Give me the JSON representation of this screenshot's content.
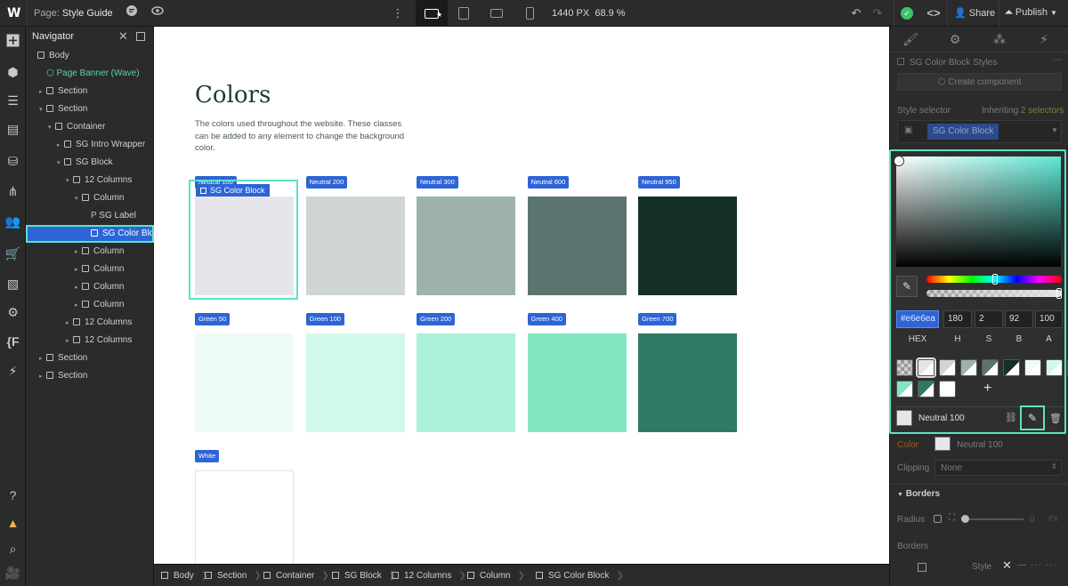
{
  "topbar": {
    "logo": "W",
    "page_prefix": "Page:",
    "page_name": "Style Guide",
    "size": "1440 PX",
    "zoom": "68.9 %",
    "share": "Share",
    "publish": "Publish"
  },
  "navigator": {
    "title": "Navigator",
    "rows": [
      {
        "label": "Body",
        "indent": 0,
        "caret": "",
        "kind": "box"
      },
      {
        "label": "Page Banner (Wave)",
        "indent": 1,
        "caret": "",
        "kind": "component"
      },
      {
        "label": "Section",
        "indent": 1,
        "caret": "▸",
        "kind": "box"
      },
      {
        "label": "Section",
        "indent": 1,
        "caret": "▾",
        "kind": "box"
      },
      {
        "label": "Container",
        "indent": 2,
        "caret": "▾",
        "kind": "box"
      },
      {
        "label": "SG Intro Wrapper",
        "indent": 3,
        "caret": "▸",
        "kind": "box"
      },
      {
        "label": "SG Block",
        "indent": 3,
        "caret": "▾",
        "kind": "box"
      },
      {
        "label": "12 Columns",
        "indent": 4,
        "caret": "▾",
        "kind": "box"
      },
      {
        "label": "Column",
        "indent": 5,
        "caret": "▾",
        "kind": "box"
      },
      {
        "label": "SG Label",
        "indent": 6,
        "caret": "",
        "kind": "p"
      },
      {
        "label": "SG Color Bloc",
        "indent": 6,
        "caret": "",
        "kind": "box",
        "selected": true
      },
      {
        "label": "Column",
        "indent": 5,
        "caret": "▸",
        "kind": "box"
      },
      {
        "label": "Column",
        "indent": 5,
        "caret": "▸",
        "kind": "box"
      },
      {
        "label": "Column",
        "indent": 5,
        "caret": "▸",
        "kind": "box"
      },
      {
        "label": "Column",
        "indent": 5,
        "caret": "▸",
        "kind": "box"
      },
      {
        "label": "12 Columns",
        "indent": 4,
        "caret": "▸",
        "kind": "box"
      },
      {
        "label": "12 Columns",
        "indent": 4,
        "caret": "▸",
        "kind": "box"
      },
      {
        "label": "Section",
        "indent": 1,
        "caret": "▸",
        "kind": "box"
      },
      {
        "label": "Section",
        "indent": 1,
        "caret": "▸",
        "kind": "box"
      }
    ]
  },
  "canvas": {
    "title": "Colors",
    "description": "The colors used throughout the website. These classes can be added to any element to change the background color.",
    "selected_tag": "SG Color Block",
    "swatches": [
      {
        "label": "Neutral 100",
        "color": "#e6e6ea"
      },
      {
        "label": "Neutral 200",
        "color": "#d0d6d5"
      },
      {
        "label": "Neutral 300",
        "color": "#9db2ad"
      },
      {
        "label": "Neutral 600",
        "color": "#5c746f"
      },
      {
        "label": "Neutral 950",
        "color": "#143029"
      },
      {
        "label": "Green 50",
        "color": "#effbf6"
      },
      {
        "label": "Green 100",
        "color": "#d2f8ea"
      },
      {
        "label": "Green 200",
        "color": "#aaf2d8"
      },
      {
        "label": "Green 400",
        "color": "#80e6c0"
      },
      {
        "label": "Green 700",
        "color": "#2e7a64"
      },
      {
        "label": "White",
        "color": "#ffffff"
      }
    ]
  },
  "breadcrumbs": [
    "Body",
    "Section",
    "Container",
    "SG Block",
    "12 Columns",
    "Column",
    "SG Color Block"
  ],
  "right_panel": {
    "styles_label": "SG Color Block Styles",
    "create_component": "Create component",
    "style_selector": "Style selector",
    "inheriting": "Inheriting",
    "inheriting_count": "2 selectors",
    "selector_chip": "SG Color Block",
    "color_label": "Color",
    "color_value": "Neutral 100",
    "clipping_label": "Clipping",
    "clipping_value": "None",
    "borders_header": "Borders",
    "radius_label": "Radius",
    "radius_value": "0",
    "radius_unit": "PX",
    "borders_label": "Borders",
    "style_label": "Style"
  },
  "picker": {
    "hex": "#e6e6ea",
    "h": "180",
    "s": "2",
    "b": "92",
    "a": "100",
    "labels": [
      "HEX",
      "H",
      "S",
      "B",
      "A"
    ],
    "swatch_name": "Neutral 100",
    "add_symbol": "+",
    "swatches": [
      "#e6e6ea",
      "#d0d6d5",
      "#9db2ad",
      "#5c746f",
      "#143029",
      "#effbf6",
      "#d2f8ea",
      "#aaf2d8",
      "#80e6c0",
      "#2e7a64",
      "#ffffff"
    ]
  },
  "icons": {
    "rail": [
      "add-icon",
      "cube-icon",
      "navigator-icon",
      "pages-icon",
      "cms-icon",
      "logic-icon",
      "users-icon",
      "ecommerce-icon",
      "assets-icon",
      "settings-icon",
      "variables-icon",
      "apps-icon",
      "help-icon",
      "warning-icon",
      "search-icon",
      "video-icon"
    ]
  }
}
